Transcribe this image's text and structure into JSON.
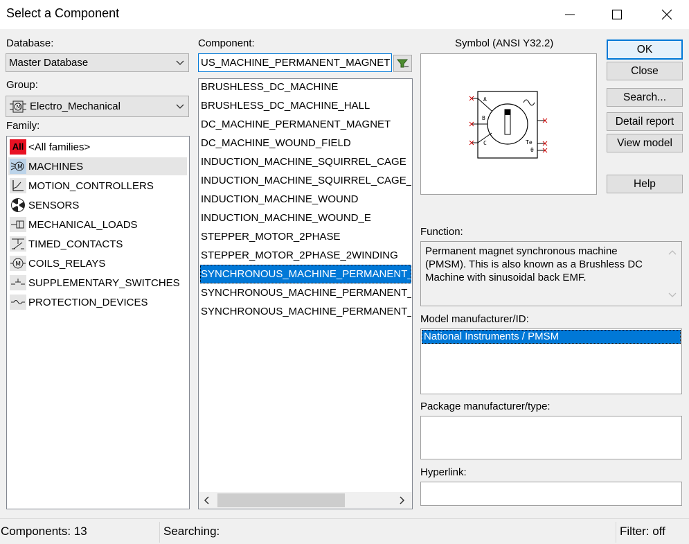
{
  "window": {
    "title": "Select a Component",
    "minimize_glyph": "—",
    "close_glyph": "✕"
  },
  "database": {
    "label": "Database:",
    "value": "Master Database"
  },
  "group": {
    "label": "Group:",
    "value": "Electro_Mechanical",
    "icon": "electromechanical-icon"
  },
  "family": {
    "label": "Family:",
    "items": [
      {
        "label": "<All families>",
        "icon": "all-families-icon"
      },
      {
        "label": "MACHINES",
        "icon": "machine-icon"
      },
      {
        "label": "MOTION_CONTROLLERS",
        "icon": "motion-controller-icon"
      },
      {
        "label": "SENSORS",
        "icon": "sensor-icon"
      },
      {
        "label": "MECHANICAL_LOADS",
        "icon": "mechanical-load-icon"
      },
      {
        "label": "TIMED_CONTACTS",
        "icon": "timed-contact-icon"
      },
      {
        "label": "COILS_RELAYS",
        "icon": "coil-relay-icon"
      },
      {
        "label": "SUPPLEMENTARY_SWITCHES",
        "icon": "switch-icon"
      },
      {
        "label": "PROTECTION_DEVICES",
        "icon": "protection-device-icon"
      }
    ],
    "all_badge": "All"
  },
  "component": {
    "label": "Component:",
    "search_value": "US_MACHINE_PERMANENT_MAGNET",
    "items": [
      "BRUSHLESS_DC_MACHINE",
      "BRUSHLESS_DC_MACHINE_HALL",
      "DC_MACHINE_PERMANENT_MAGNET",
      "DC_MACHINE_WOUND_FIELD",
      "INDUCTION_MACHINE_SQUIRREL_CAGE",
      "INDUCTION_MACHINE_SQUIRREL_CAGE_",
      "INDUCTION_MACHINE_WOUND",
      "INDUCTION_MACHINE_WOUND_E",
      "STEPPER_MOTOR_2PHASE",
      "STEPPER_MOTOR_2PHASE_2WINDING",
      "SYNCHRONOUS_MACHINE_PERMANENT_",
      "SYNCHRONOUS_MACHINE_PERMANENT_",
      "SYNCHRONOUS_MACHINE_PERMANENT_"
    ],
    "selected_index": 10
  },
  "symbol": {
    "label": "Symbol (ANSI Y32.2)",
    "pins": {
      "a": "A",
      "b": "B",
      "c": "C",
      "te": "Te",
      "theta": "θ"
    }
  },
  "buttons": {
    "ok": "OK",
    "close": "Close",
    "search": "Search...",
    "detail_report": "Detail report",
    "view_model": "View model",
    "help": "Help"
  },
  "function": {
    "label": "Function:",
    "text": "Permanent magnet synchronous machine (PMSM). This is also known as a Brushless DC Machine with sinusoidal back EMF."
  },
  "model_manufacturer": {
    "label": "Model manufacturer/ID:",
    "selected": "National Instruments / PMSM"
  },
  "package": {
    "label": "Package manufacturer/type:",
    "value": ""
  },
  "hyperlink": {
    "label": "Hyperlink:",
    "value": ""
  },
  "status": {
    "components": "Components: 13",
    "searching": "Searching:",
    "filter": "Filter: off"
  },
  "colors": {
    "selection": "#0078d7",
    "accent_red": "#e81123"
  }
}
